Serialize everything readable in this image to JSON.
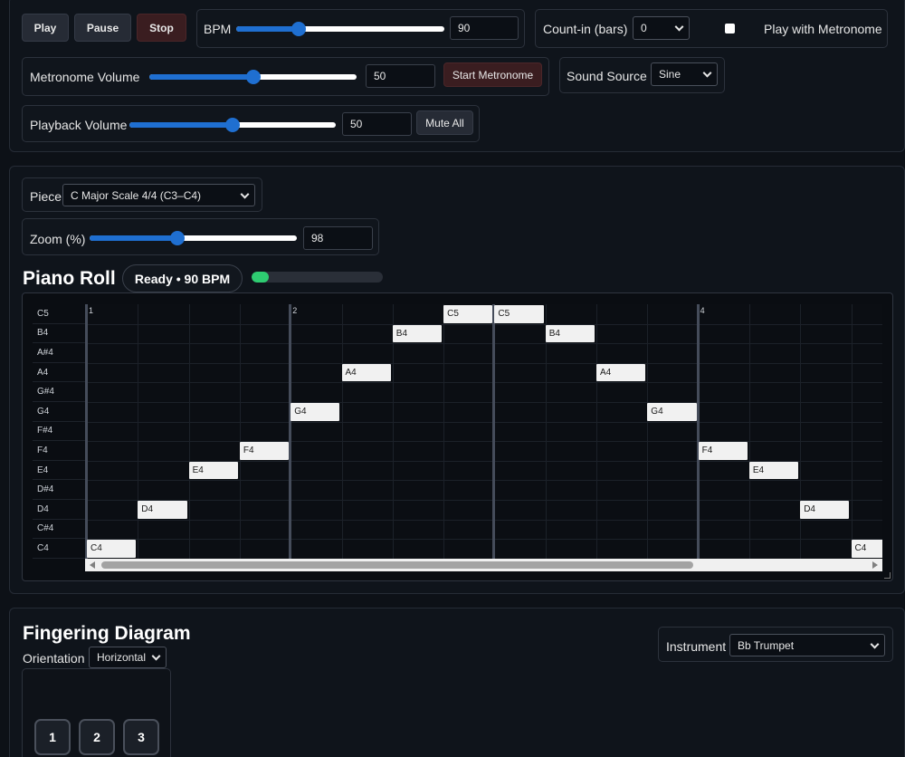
{
  "transport": {
    "play_label": "Play",
    "pause_label": "Pause",
    "stop_label": "Stop",
    "bpm_label": "BPM",
    "bpm_value": "90",
    "bpm_slider": {
      "min": 30,
      "max": 240,
      "value": 90
    },
    "countin_label": "Count-in (bars)",
    "countin_value": "0",
    "play_with_metronome_label": "Play with Metronome",
    "metronome_volume_label": "Metronome Volume",
    "metronome_volume_value": "50",
    "metronome_volume_slider": {
      "min": 0,
      "max": 100,
      "value": 50
    },
    "start_metronome_label": "Start Metronome",
    "sound_source_label": "Sound Source",
    "sound_source_value": "Sine",
    "playback_volume_label": "Playback Volume",
    "playback_volume_value": "50",
    "playback_volume_slider": {
      "min": 0,
      "max": 100,
      "value": 50
    },
    "mute_all_label": "Mute All"
  },
  "roll": {
    "piece_label": "Piece",
    "piece_value": "C Major Scale 4/4 (C3–C4)",
    "zoom_label": "Zoom (%)",
    "zoom_value": "98",
    "zoom_slider": {
      "min": 25,
      "max": 200,
      "value": 98
    },
    "heading": "Piano Roll",
    "status": "Ready • 90 BPM",
    "progress": 0.13,
    "pitches": [
      "C5",
      "B4",
      "A#4",
      "A4",
      "G#4",
      "G4",
      "F#4",
      "F4",
      "E4",
      "D#4",
      "D4",
      "C#4",
      "C4"
    ],
    "bar_numbers": [
      "1",
      "2",
      "",
      "4"
    ],
    "notes": [
      {
        "pitch": "C4",
        "beat": 0
      },
      {
        "pitch": "D4",
        "beat": 1
      },
      {
        "pitch": "E4",
        "beat": 2
      },
      {
        "pitch": "F4",
        "beat": 3
      },
      {
        "pitch": "G4",
        "beat": 4
      },
      {
        "pitch": "A4",
        "beat": 5
      },
      {
        "pitch": "B4",
        "beat": 6
      },
      {
        "pitch": "C5",
        "beat": 7
      },
      {
        "pitch": "C5",
        "beat": 8
      },
      {
        "pitch": "B4",
        "beat": 9
      },
      {
        "pitch": "A4",
        "beat": 10
      },
      {
        "pitch": "G4",
        "beat": 11
      },
      {
        "pitch": "F4",
        "beat": 12
      },
      {
        "pitch": "E4",
        "beat": 13
      },
      {
        "pitch": "D4",
        "beat": 14
      },
      {
        "pitch": "C4",
        "beat": 15
      }
    ]
  },
  "fingering": {
    "heading": "Fingering Diagram",
    "orientation_label": "Orientation",
    "orientation_value": "Horizontal",
    "instrument_label": "Instrument",
    "instrument_value": "Bb Trumpet",
    "valves": [
      "1",
      "2",
      "3"
    ]
  }
}
